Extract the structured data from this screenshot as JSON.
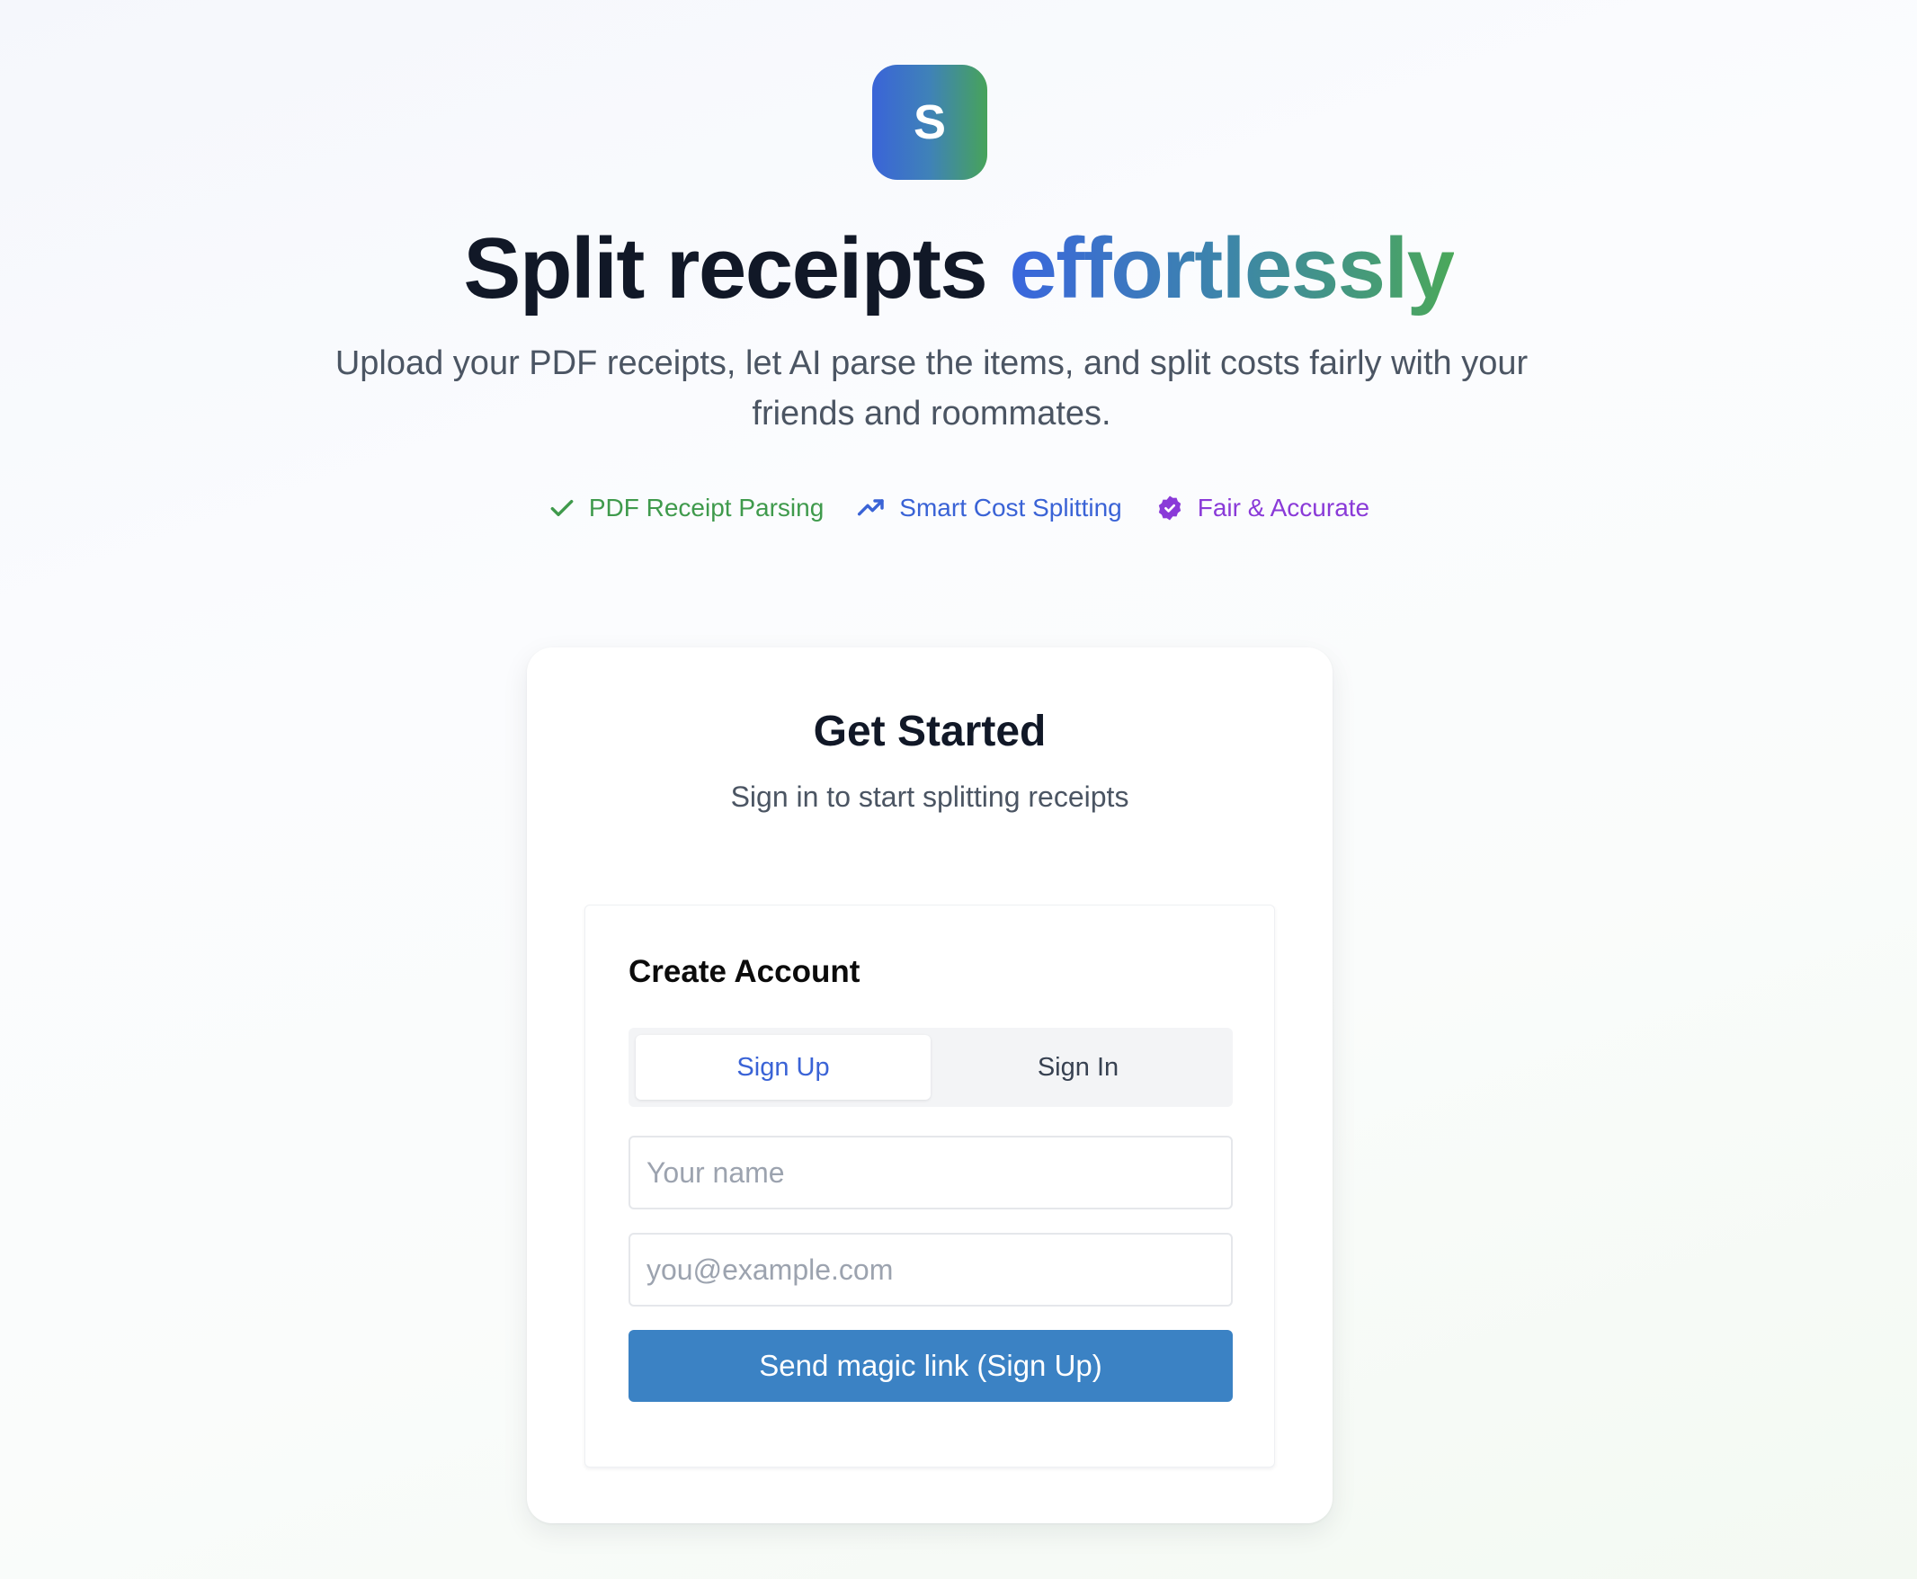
{
  "logo": {
    "letter": "S"
  },
  "hero": {
    "headline_main": "Split receipts ",
    "headline_accent": "effortlessly",
    "subtitle": "Upload your PDF receipts, let AI parse the items, and split costs fairly with your friends and roommates."
  },
  "features": [
    {
      "label": "PDF Receipt Parsing",
      "icon": "check-icon",
      "color": "#3f9a4c"
    },
    {
      "label": "Smart Cost Splitting",
      "icon": "trending-up-icon",
      "color": "#3a63d6"
    },
    {
      "label": "Fair & Accurate",
      "icon": "badge-check-icon",
      "color": "#8a3ad8"
    }
  ],
  "card": {
    "title": "Get Started",
    "subtitle": "Sign in to start splitting receipts"
  },
  "auth": {
    "title": "Create Account",
    "tabs": [
      {
        "label": "Sign Up",
        "active": true
      },
      {
        "label": "Sign In",
        "active": false
      }
    ],
    "name_placeholder": "Your name",
    "email_placeholder": "you@example.com",
    "submit_label": "Send magic link (Sign Up)"
  },
  "colors": {
    "primary_button": "#3b82c4",
    "active_tab_text": "#3a63d6",
    "gradient_start": "#3a64d8",
    "gradient_end": "#47a35a"
  }
}
